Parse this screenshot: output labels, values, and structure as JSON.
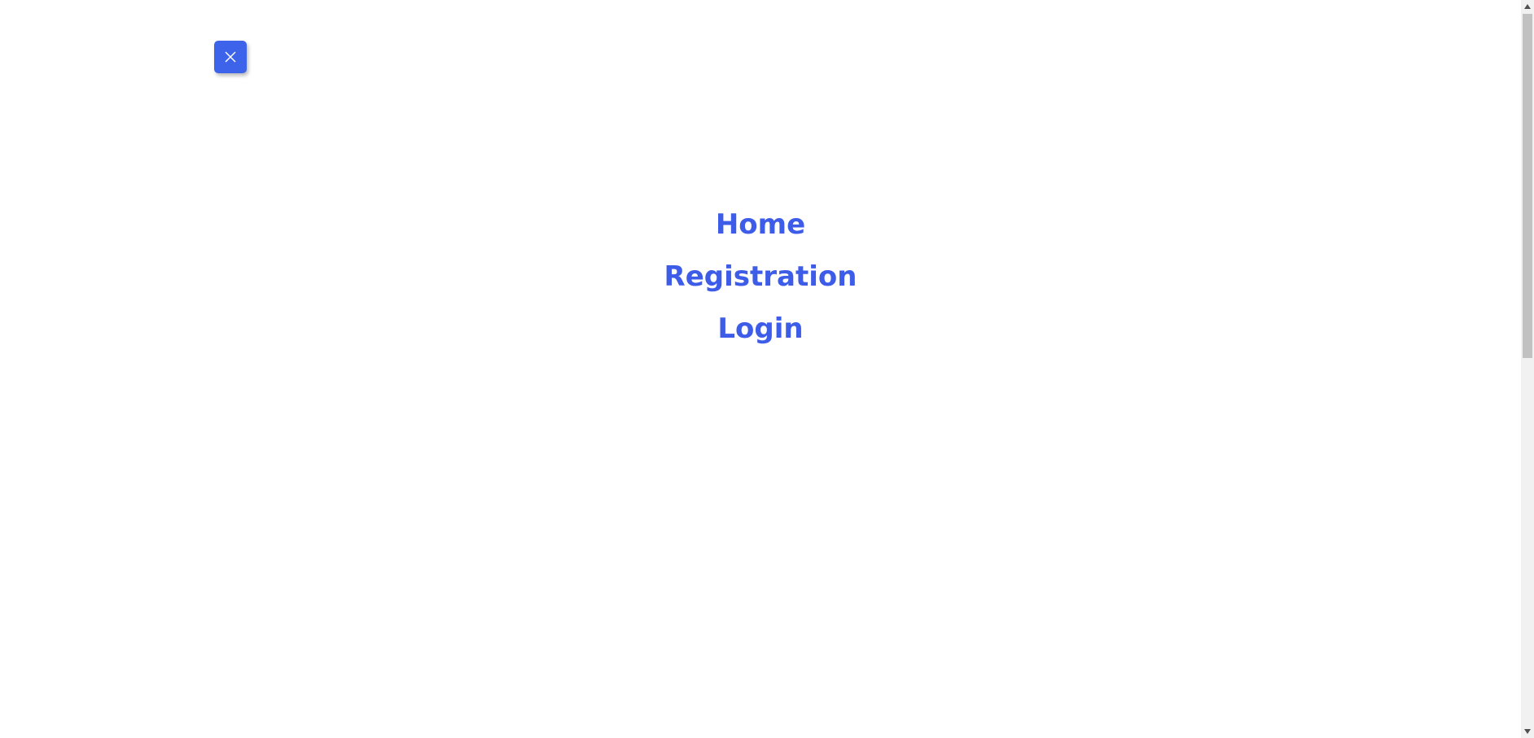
{
  "close_button": {
    "icon": "close-icon",
    "background": "#3d63ea",
    "icon_color": "#ffffff"
  },
  "nav": {
    "link_color": "#3d5ce8",
    "items": [
      {
        "label": "Home"
      },
      {
        "label": "Registration"
      },
      {
        "label": "Login"
      }
    ]
  },
  "scrollbar": {
    "up_icon": "triangle-up-icon",
    "down_icon": "triangle-down-icon"
  }
}
